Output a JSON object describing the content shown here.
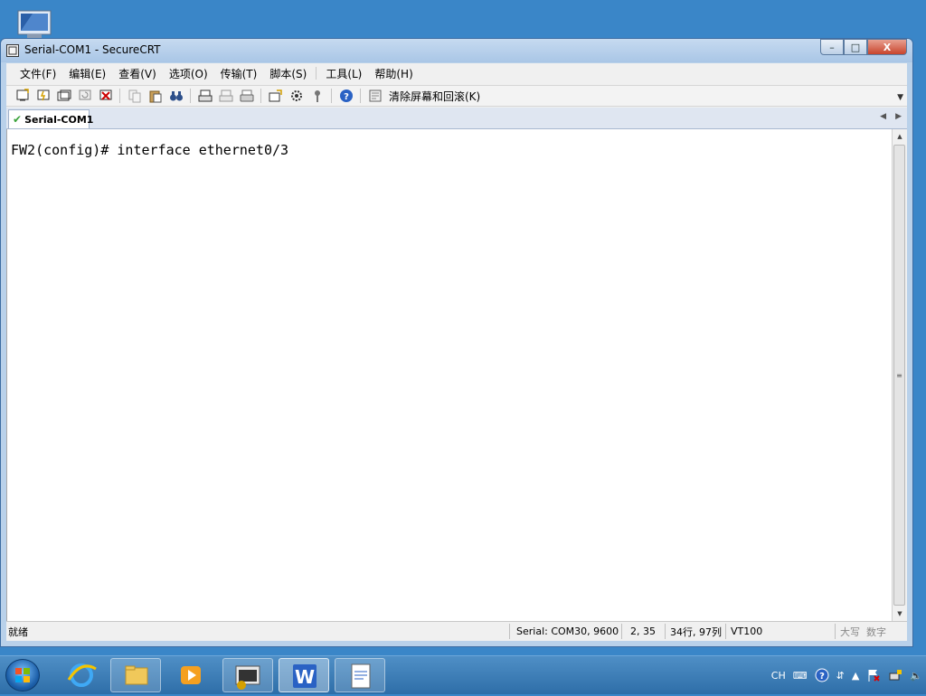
{
  "window": {
    "title": "Serial-COM1 - SecureCRT",
    "controls": {
      "minimize": "–",
      "maximize": "□",
      "close": "X"
    }
  },
  "menubar": {
    "items": [
      {
        "label": "文件(F)"
      },
      {
        "label": "编辑(E)"
      },
      {
        "label": "查看(V)"
      },
      {
        "label": "选项(O)"
      },
      {
        "label": "传输(T)"
      },
      {
        "label": "脚本(S)"
      },
      {
        "label": "工具(L)"
      },
      {
        "label": "帮助(H)"
      }
    ]
  },
  "toolbar": {
    "clear_label": "清除屏幕和回滚(K)",
    "icons": [
      "connect-icon",
      "quick-connect-icon",
      "connect-tab-icon",
      "reconnect-icon",
      "disconnect-icon",
      "copy-icon",
      "paste-icon",
      "find-icon",
      "print-screen-icon",
      "print-selection-icon",
      "print-icon",
      "session-options-icon",
      "global-options-icon",
      "keymap-icon",
      "help-icon",
      "clear-screen-icon"
    ]
  },
  "tabs": [
    {
      "label": "Serial-COM1",
      "icon": "check-icon"
    }
  ],
  "terminal": {
    "lines": [
      "FW2(config)# interface ethernet0/3"
    ]
  },
  "statusbar": {
    "ready": "就绪",
    "serial": "Serial: COM30, 9600",
    "cursor": "2,  35",
    "size": "34行, 97列",
    "emulation": "VT100",
    "caps": "大写",
    "num": "数字"
  },
  "taskbar": {
    "tray": {
      "lang": "CH"
    }
  },
  "colors": {
    "desktop": "#3a86c8",
    "titlebar": "#b9d1ea",
    "close_button": "#c8442c",
    "tab_check": "#3aa23a"
  }
}
